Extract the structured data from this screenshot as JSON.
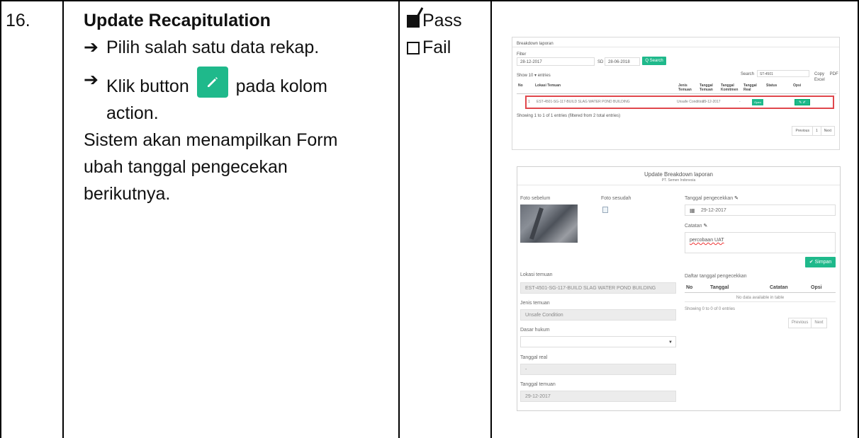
{
  "row": {
    "number": "16.",
    "title": "Update Recapitulation",
    "steps": [
      "Pilih salah satu data rekap.",
      "Klik button",
      "pada kolom",
      "action."
    ],
    "description_lines": [
      "Sistem akan menampilkan Form",
      "ubah tanggal pengecekan",
      "berikutnya."
    ],
    "results": {
      "pass_label": "Pass",
      "fail_label": "Fail",
      "pass_checked": true,
      "fail_checked": false
    },
    "colors": {
      "accent": "#1fb98b",
      "highlight": "#e0474c"
    }
  },
  "list_screen": {
    "header": "Breakdown laporan",
    "filter_label": "Filter",
    "date_from": "28-12-2017",
    "sd_label": "SD",
    "date_to": "28-06-2018",
    "search_button": "Q Search",
    "show_label": "Show  10   ▾ entries",
    "search_in_label": "Search",
    "search_value": "ST-4501",
    "export_buttons": "Copy   PDF   Excel",
    "columns": [
      "No",
      "Lokasi Temuan",
      "Jenis Temuan",
      "Tanggal Temuan",
      "Tanggal Komitmen",
      "Tanggal Real",
      "Status",
      "Opsi"
    ],
    "row": {
      "no": "1",
      "lokasi": "EST-4501-SG-117-BUILD SLAG WATER POND BUILDING",
      "jenis": "Unsafe Condition",
      "tanggal_temuan": "29-12-2017",
      "tanggal_real": "-",
      "status": "Open"
    },
    "showing": "Showing 1 to 1 of 1 entries (filtered from 2 total entries)",
    "pager": [
      "Previous",
      "1",
      "Next"
    ]
  },
  "form_screen": {
    "title": "Update Breakdown laporan",
    "subtitle": "PT. Semen Indonesia",
    "foto_sebelum": "Foto sebelum",
    "foto_sesudah": "Foto sesudah",
    "tanggal_label": "Tanggal pengecekkan",
    "tanggal_value": "29-12-2017",
    "catatan_label": "Catatan",
    "catatan_value": "percobaan UAT",
    "simpan_label": "✔ Simpan",
    "lokasi_label": "Lokasi temuan",
    "lokasi_value": "EST-4501-SG-117-BUILD SLAG WATER POND BUILDING",
    "jenis_label": "Jenis temuan",
    "jenis_value": "Unsafe Condition",
    "dasar_label": "Dasar hukum",
    "real_label": "Tanggal real",
    "real_value": "-",
    "temuan_label": "Tanggal temuan",
    "temuan_value": "29-12-2017",
    "daftar_label": "Daftar tanggal pengecekkan",
    "daftar_columns": [
      "No",
      "Tanggal",
      "Catatan",
      "Opsi"
    ],
    "nodata": "No data available in table",
    "showing": "Showing 0 to 0 of 0 entries",
    "pager": [
      "Previous",
      "Next"
    ]
  }
}
